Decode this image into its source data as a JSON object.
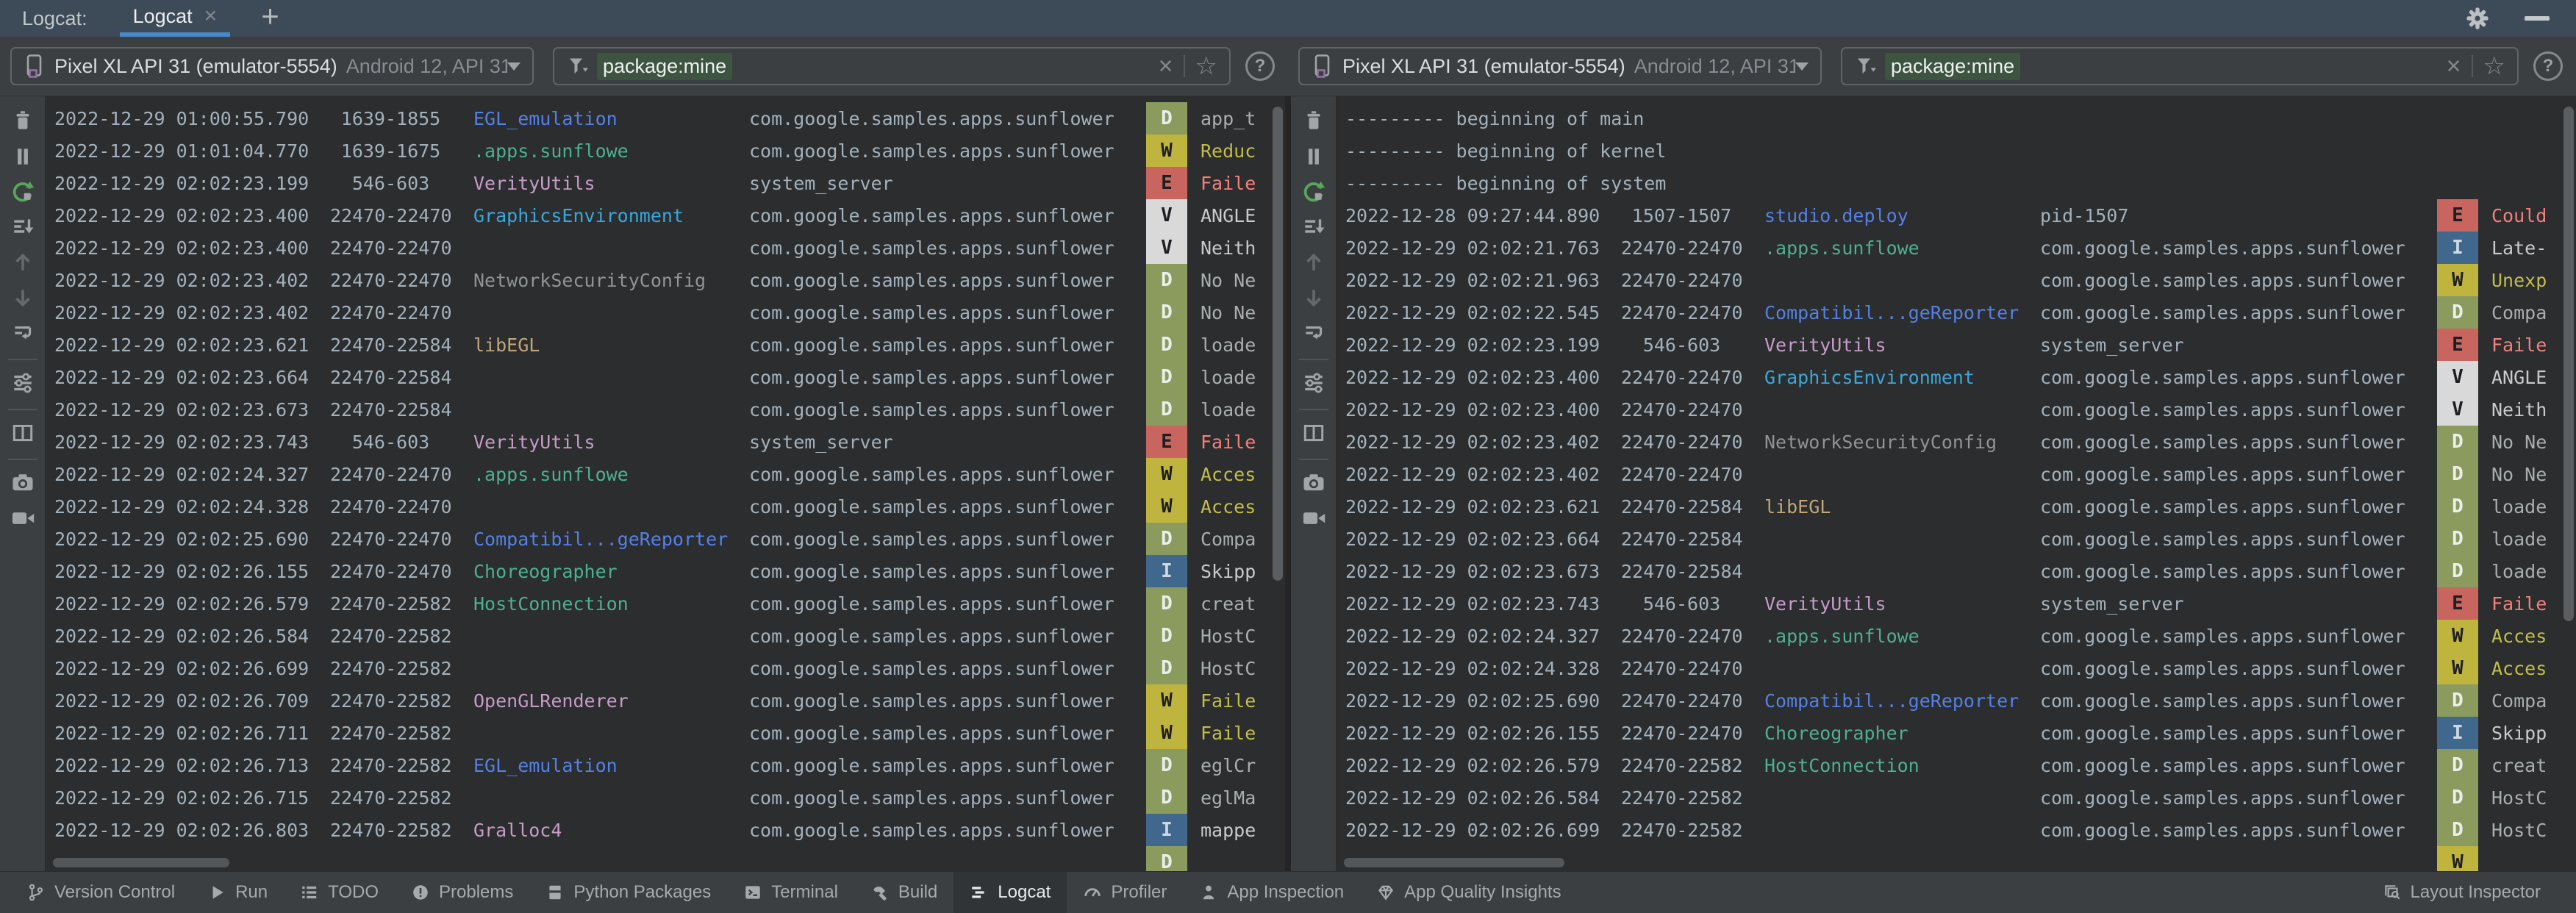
{
  "header": {
    "group_label": "Logcat:",
    "tab_label": "Logcat",
    "close_icon": "×",
    "add_tab_icon": "+"
  },
  "toolbar_icons": [
    "clear-logcat",
    "pause-logcat",
    "restart-logcat",
    "scroll-to-end",
    "previous-occurrence",
    "next-occurrence",
    "soft-wrap",
    "separator",
    "logcat-settings",
    "separator",
    "split-panels",
    "separator",
    "take-screenshot",
    "record-screen"
  ],
  "panes": [
    {
      "device": {
        "name": "Pixel XL API 31 (emulator-5554)",
        "details": "Android 12, API 31"
      },
      "filter": {
        "value": "package:mine",
        "clear_icon": "×",
        "favorite_icon": "☆",
        "help_icon": "?"
      },
      "rows": [
        {
          "time": "2022-12-29 01:00:55.790",
          "pids": "1639-1855",
          "tag": "EGL_emulation",
          "tag_color": "blue",
          "package": "com.google.samples.apps.sunflower",
          "level": "D",
          "message": "app_t"
        },
        {
          "time": "2022-12-29 01:01:04.770",
          "pids": "1639-1675",
          "tag": ".apps.sunflowe",
          "tag_color": "teal",
          "package": "com.google.samples.apps.sunflower",
          "level": "W",
          "message": "Reduc"
        },
        {
          "time": "2022-12-29 02:02:23.199",
          "pids": "546-603",
          "tag": "VerityUtils",
          "tag_color": "pink",
          "package": "system_server",
          "level": "E",
          "message": "Faile"
        },
        {
          "time": "2022-12-29 02:02:23.400",
          "pids": "22470-22470",
          "tag": "GraphicsEnvironment",
          "tag_color": "lightblue",
          "package": "com.google.samples.apps.sunflower",
          "level": "V",
          "message": "ANGLE"
        },
        {
          "time": "2022-12-29 02:02:23.400",
          "pids": "22470-22470",
          "tag": "",
          "package": "com.google.samples.apps.sunflower",
          "level": "V",
          "message": "Neith"
        },
        {
          "time": "2022-12-29 02:02:23.402",
          "pids": "22470-22470",
          "tag": "NetworkSecurityConfig",
          "tag_color": "gray",
          "package": "com.google.samples.apps.sunflower",
          "level": "D",
          "message": "No Ne"
        },
        {
          "time": "2022-12-29 02:02:23.402",
          "pids": "22470-22470",
          "tag": "",
          "package": "com.google.samples.apps.sunflower",
          "level": "D",
          "message": "No Ne"
        },
        {
          "time": "2022-12-29 02:02:23.621",
          "pids": "22470-22584",
          "tag": "libEGL",
          "tag_color": "tan",
          "package": "com.google.samples.apps.sunflower",
          "level": "D",
          "message": "loade"
        },
        {
          "time": "2022-12-29 02:02:23.664",
          "pids": "22470-22584",
          "tag": "",
          "package": "com.google.samples.apps.sunflower",
          "level": "D",
          "message": "loade"
        },
        {
          "time": "2022-12-29 02:02:23.673",
          "pids": "22470-22584",
          "tag": "",
          "package": "com.google.samples.apps.sunflower",
          "level": "D",
          "message": "loade"
        },
        {
          "time": "2022-12-29 02:02:23.743",
          "pids": "546-603",
          "tag": "VerityUtils",
          "tag_color": "pink",
          "package": "system_server",
          "level": "E",
          "message": "Faile"
        },
        {
          "time": "2022-12-29 02:02:24.327",
          "pids": "22470-22470",
          "tag": ".apps.sunflowe",
          "tag_color": "teal",
          "package": "com.google.samples.apps.sunflower",
          "level": "W",
          "message": "Acces"
        },
        {
          "time": "2022-12-29 02:02:24.328",
          "pids": "22470-22470",
          "tag": "",
          "package": "com.google.samples.apps.sunflower",
          "level": "W",
          "message": "Acces"
        },
        {
          "time": "2022-12-29 02:02:25.690",
          "pids": "22470-22470",
          "tag": "Compatibil...geReporter",
          "tag_color": "blue",
          "package": "com.google.samples.apps.sunflower",
          "level": "D",
          "message": "Compa"
        },
        {
          "time": "2022-12-29 02:02:26.155",
          "pids": "22470-22470",
          "tag": "Choreographer",
          "tag_color": "teal",
          "package": "com.google.samples.apps.sunflower",
          "level": "I",
          "message": "Skipp"
        },
        {
          "time": "2022-12-29 02:02:26.579",
          "pids": "22470-22582",
          "tag": "HostConnection",
          "tag_color": "teal",
          "package": "com.google.samples.apps.sunflower",
          "level": "D",
          "message": "creat"
        },
        {
          "time": "2022-12-29 02:02:26.584",
          "pids": "22470-22582",
          "tag": "",
          "package": "com.google.samples.apps.sunflower",
          "level": "D",
          "message": "HostC"
        },
        {
          "time": "2022-12-29 02:02:26.699",
          "pids": "22470-22582",
          "tag": "",
          "package": "com.google.samples.apps.sunflower",
          "level": "D",
          "message": "HostC"
        },
        {
          "time": "2022-12-29 02:02:26.709",
          "pids": "22470-22582",
          "tag": "OpenGLRenderer",
          "tag_color": "pink",
          "package": "com.google.samples.apps.sunflower",
          "level": "W",
          "message": "Faile"
        },
        {
          "time": "2022-12-29 02:02:26.711",
          "pids": "22470-22582",
          "tag": "",
          "package": "com.google.samples.apps.sunflower",
          "level": "W",
          "message": "Faile"
        },
        {
          "time": "2022-12-29 02:02:26.713",
          "pids": "22470-22582",
          "tag": "EGL_emulation",
          "tag_color": "blue",
          "package": "com.google.samples.apps.sunflower",
          "level": "D",
          "message": "eglCr"
        },
        {
          "time": "2022-12-29 02:02:26.715",
          "pids": "22470-22582",
          "tag": "",
          "package": "com.google.samples.apps.sunflower",
          "level": "D",
          "message": "eglMa"
        },
        {
          "time": "2022-12-29 02:02:26.803",
          "pids": "22470-22582",
          "tag": "Gralloc4",
          "tag_color": "pink",
          "package": "com.google.samples.apps.sunflower",
          "level": "I",
          "message": "mappe"
        },
        {
          "level": "D"
        }
      ]
    },
    {
      "device": {
        "name": "Pixel XL API 31 (emulator-5554)",
        "details": "Android 12, API 31"
      },
      "filter": {
        "value": "package:mine",
        "clear_icon": "×",
        "favorite_icon": "☆",
        "help_icon": "?"
      },
      "rows": [
        {
          "banner": "--------- beginning of main"
        },
        {
          "banner": "--------- beginning of kernel"
        },
        {
          "banner": "--------- beginning of system"
        },
        {
          "time": "2022-12-28 09:27:44.890",
          "pids": "1507-1507",
          "tag": "studio.deploy",
          "tag_color": "blue",
          "package": "pid-1507",
          "level": "E",
          "message": "Could"
        },
        {
          "time": "2022-12-29 02:02:21.763",
          "pids": "22470-22470",
          "tag": ".apps.sunflowe",
          "tag_color": "teal",
          "package": "com.google.samples.apps.sunflower",
          "level": "I",
          "message": "Late-"
        },
        {
          "time": "2022-12-29 02:02:21.963",
          "pids": "22470-22470",
          "tag": "",
          "package": "com.google.samples.apps.sunflower",
          "level": "W",
          "message": "Unexp"
        },
        {
          "time": "2022-12-29 02:02:22.545",
          "pids": "22470-22470",
          "tag": "Compatibil...geReporter",
          "tag_color": "blue",
          "package": "com.google.samples.apps.sunflower",
          "level": "D",
          "message": "Compa"
        },
        {
          "time": "2022-12-29 02:02:23.199",
          "pids": "546-603",
          "tag": "VerityUtils",
          "tag_color": "pink",
          "package": "system_server",
          "level": "E",
          "message": "Faile"
        },
        {
          "time": "2022-12-29 02:02:23.400",
          "pids": "22470-22470",
          "tag": "GraphicsEnvironment",
          "tag_color": "lightblue",
          "package": "com.google.samples.apps.sunflower",
          "level": "V",
          "message": "ANGLE"
        },
        {
          "time": "2022-12-29 02:02:23.400",
          "pids": "22470-22470",
          "tag": "",
          "package": "com.google.samples.apps.sunflower",
          "level": "V",
          "message": "Neith"
        },
        {
          "time": "2022-12-29 02:02:23.402",
          "pids": "22470-22470",
          "tag": "NetworkSecurityConfig",
          "tag_color": "gray",
          "package": "com.google.samples.apps.sunflower",
          "level": "D",
          "message": "No Ne"
        },
        {
          "time": "2022-12-29 02:02:23.402",
          "pids": "22470-22470",
          "tag": "",
          "package": "com.google.samples.apps.sunflower",
          "level": "D",
          "message": "No Ne"
        },
        {
          "time": "2022-12-29 02:02:23.621",
          "pids": "22470-22584",
          "tag": "libEGL",
          "tag_color": "tan",
          "package": "com.google.samples.apps.sunflower",
          "level": "D",
          "message": "loade"
        },
        {
          "time": "2022-12-29 02:02:23.664",
          "pids": "22470-22584",
          "tag": "",
          "package": "com.google.samples.apps.sunflower",
          "level": "D",
          "message": "loade"
        },
        {
          "time": "2022-12-29 02:02:23.673",
          "pids": "22470-22584",
          "tag": "",
          "package": "com.google.samples.apps.sunflower",
          "level": "D",
          "message": "loade"
        },
        {
          "time": "2022-12-29 02:02:23.743",
          "pids": "546-603",
          "tag": "VerityUtils",
          "tag_color": "pink",
          "package": "system_server",
          "level": "E",
          "message": "Faile"
        },
        {
          "time": "2022-12-29 02:02:24.327",
          "pids": "22470-22470",
          "tag": ".apps.sunflowe",
          "tag_color": "teal",
          "package": "com.google.samples.apps.sunflower",
          "level": "W",
          "message": "Acces"
        },
        {
          "time": "2022-12-29 02:02:24.328",
          "pids": "22470-22470",
          "tag": "",
          "package": "com.google.samples.apps.sunflower",
          "level": "W",
          "message": "Acces"
        },
        {
          "time": "2022-12-29 02:02:25.690",
          "pids": "22470-22470",
          "tag": "Compatibil...geReporter",
          "tag_color": "blue",
          "package": "com.google.samples.apps.sunflower",
          "level": "D",
          "message": "Compa"
        },
        {
          "time": "2022-12-29 02:02:26.155",
          "pids": "22470-22470",
          "tag": "Choreographer",
          "tag_color": "teal",
          "package": "com.google.samples.apps.sunflower",
          "level": "I",
          "message": "Skipp"
        },
        {
          "time": "2022-12-29 02:02:26.579",
          "pids": "22470-22582",
          "tag": "HostConnection",
          "tag_color": "teal",
          "package": "com.google.samples.apps.sunflower",
          "level": "D",
          "message": "creat"
        },
        {
          "time": "2022-12-29 02:02:26.584",
          "pids": "22470-22582",
          "tag": "",
          "package": "com.google.samples.apps.sunflower",
          "level": "D",
          "message": "HostC"
        },
        {
          "time": "2022-12-29 02:02:26.699",
          "pids": "22470-22582",
          "tag": "",
          "package": "com.google.samples.apps.sunflower",
          "level": "D",
          "message": "HostC"
        },
        {
          "level": "W"
        }
      ]
    }
  ],
  "levels": {
    "V": {
      "badge_bg": "#D9D9D9",
      "badge_fg": "#1E1F22",
      "msg_color": "#C7CBCD"
    },
    "D": {
      "badge_bg": "#8A9B5D",
      "badge_fg": "#EDEDED",
      "msg_color": "#A9AEB1"
    },
    "I": {
      "badge_bg": "#40678C",
      "badge_fg": "#CFD8E0",
      "msg_color": "#C7CBCD"
    },
    "W": {
      "badge_bg": "#BFB43E",
      "badge_fg": "#1E1F22",
      "msg_color": "#C3BD4B"
    },
    "E": {
      "badge_bg": "#C9655F",
      "badge_fg": "#1E1F22",
      "msg_color": "#F2817D"
    }
  },
  "tag_colors": {
    "blue": "#5481E6",
    "lightblue": "#39A8DC",
    "teal": "#4FB08F",
    "pink": "#C79BC8",
    "gray": "#8F9496",
    "tan": "#C2A678"
  },
  "colors": {
    "tab_accent": "#4A88C7",
    "filter_highlight": "#3D5441",
    "restart_green": "#57A65A",
    "device_icon_accent": "#9876AA",
    "meta_text": "#A3B1BC"
  },
  "statusbar": {
    "left_items": [
      {
        "label": "Version Control",
        "icon": "version-control"
      },
      {
        "label": "Run",
        "icon": "run"
      },
      {
        "label": "TODO",
        "icon": "todo"
      },
      {
        "label": "Problems",
        "icon": "problems"
      },
      {
        "label": "Python Packages",
        "icon": "python-packages"
      },
      {
        "label": "Terminal",
        "icon": "terminal"
      },
      {
        "label": "Build",
        "icon": "build"
      },
      {
        "label": "Logcat",
        "icon": "logcat",
        "selected": true
      },
      {
        "label": "Profiler",
        "icon": "profiler"
      },
      {
        "label": "App Inspection",
        "icon": "app-inspection"
      },
      {
        "label": "App Quality Insights",
        "icon": "app-quality-insights"
      }
    ],
    "right_items": [
      {
        "label": "Layout Inspector",
        "icon": "layout-inspector"
      }
    ]
  }
}
